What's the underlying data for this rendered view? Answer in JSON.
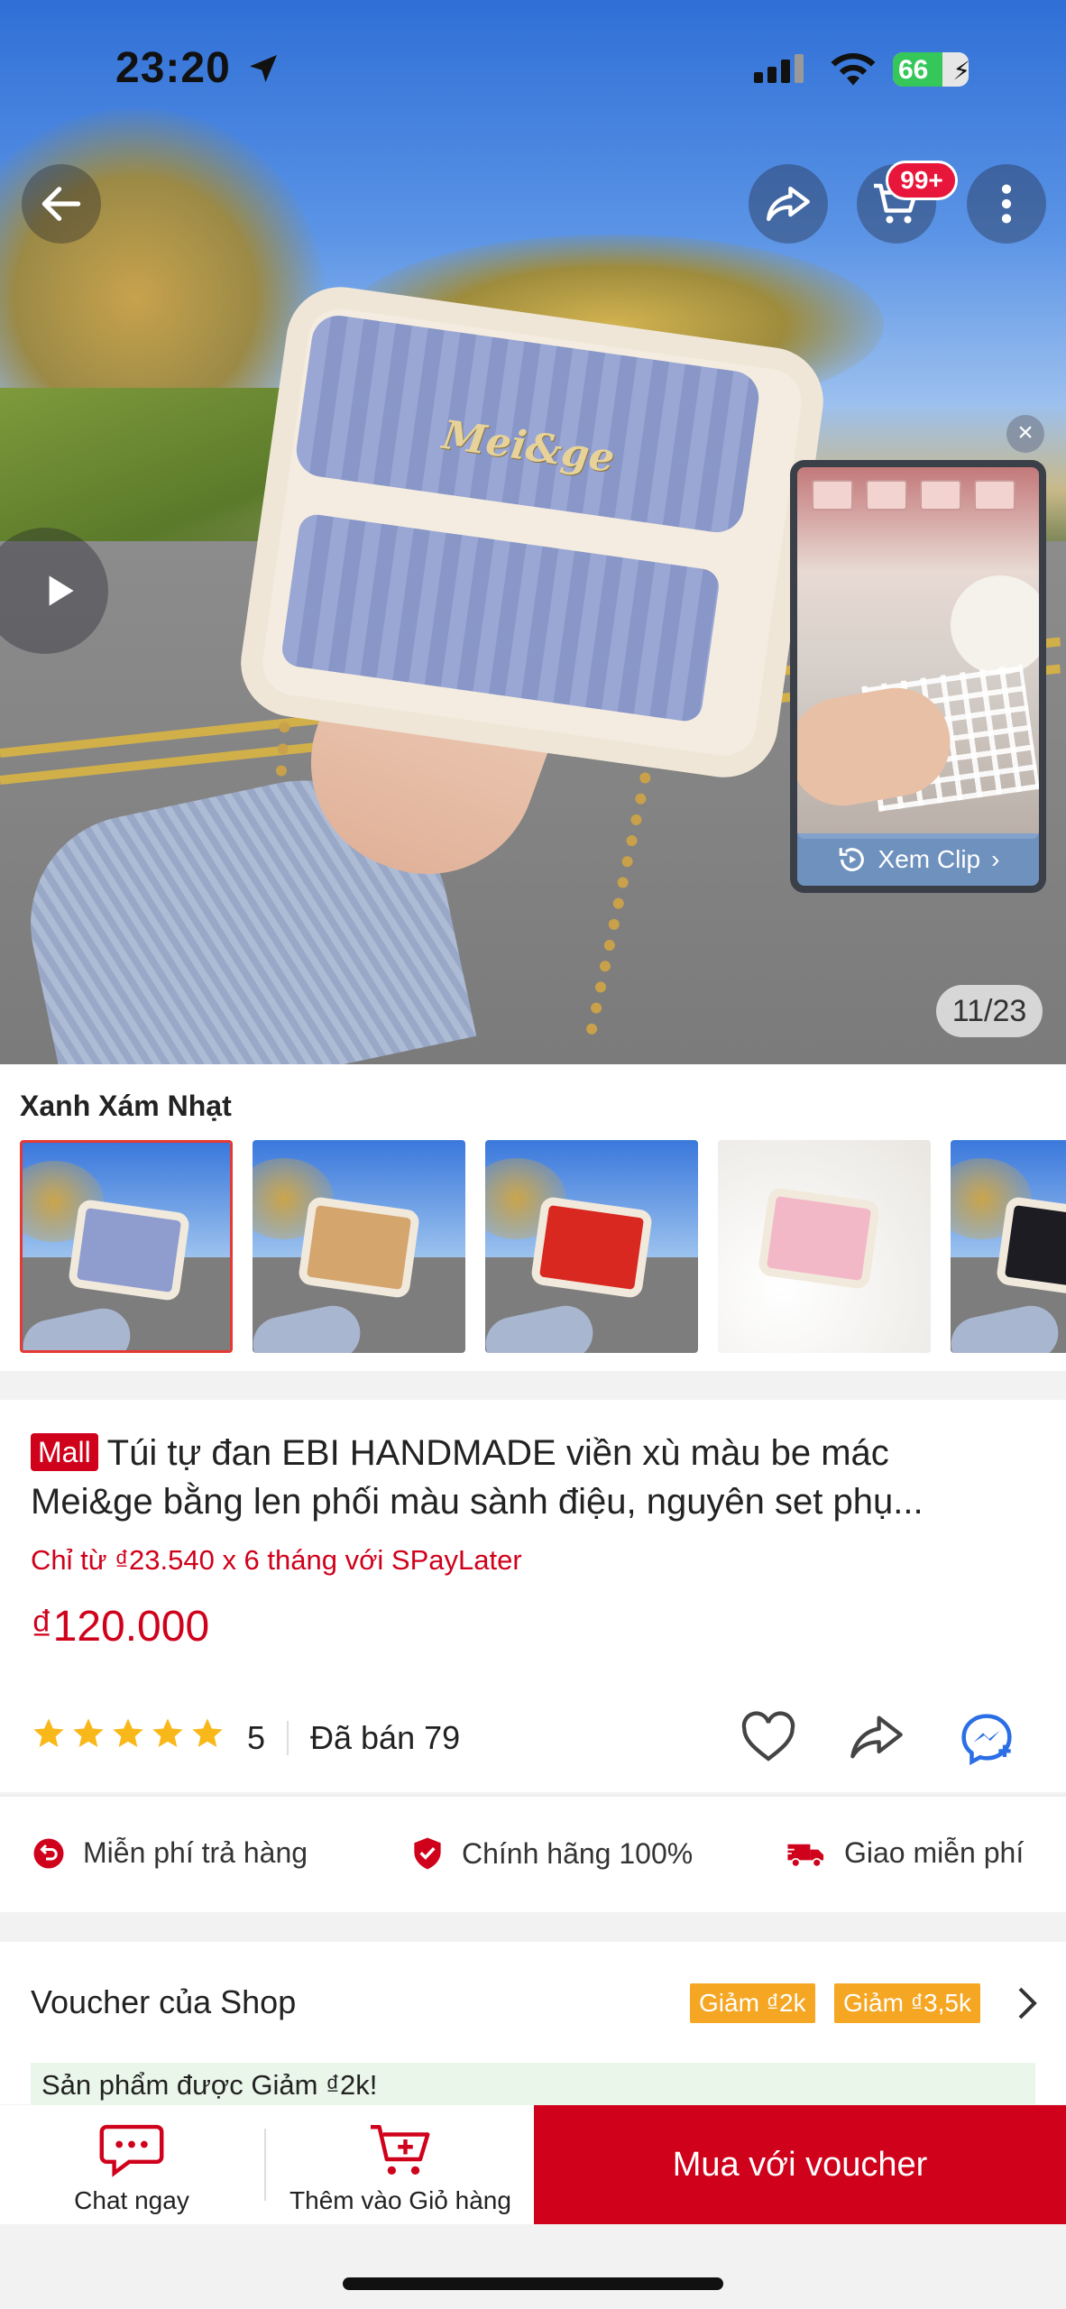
{
  "status_bar": {
    "time": "23:20",
    "battery": "66",
    "battery_level": 0.66
  },
  "hero": {
    "image_counter": "11/23",
    "cart_badge": "99+",
    "bag_brand": "Mei&ge",
    "clip": {
      "label": "Xem Clip"
    }
  },
  "variants": {
    "selected_label": "Xanh Xám Nhạt",
    "colors": [
      "#8f9dce",
      "#d4a56c",
      "#d8281f",
      "#f3b8c8",
      "#1c1c22"
    ]
  },
  "product": {
    "mall_badge": "Mall",
    "title_line1": "Túi tự đan EBI HANDMADE viền xù màu be mác",
    "title_line2": "Mei&ge bằng len phối màu sành điệu, nguyên set phụ...",
    "paylater": "Chỉ từ ₫23.540 x 6 tháng với SPayLater",
    "price": "₫120.000",
    "rating": "5",
    "sold": "Đã bán 79",
    "stars": 5
  },
  "benefits": [
    {
      "icon": "return-icon",
      "label": "Miễn phí trả hàng"
    },
    {
      "icon": "shield-check-icon",
      "label": "Chính hãng 100%"
    },
    {
      "icon": "truck-icon",
      "label": "Giao miễn phí"
    }
  ],
  "voucher": {
    "title": "Voucher của Shop",
    "tags": [
      "Giảm ₫2k",
      "Giảm ₫3,5k"
    ],
    "note": "Sản phẩm được Giảm ₫2k!"
  },
  "bottom_bar": {
    "chat_label": "Chat ngay",
    "cart_label": "Thêm vào Giỏ hàng",
    "buy_label": "Mua với voucher"
  },
  "colors": {
    "accent": "#d0011b",
    "voucher_tag": "#f5a623",
    "star": "#f9b81a"
  }
}
